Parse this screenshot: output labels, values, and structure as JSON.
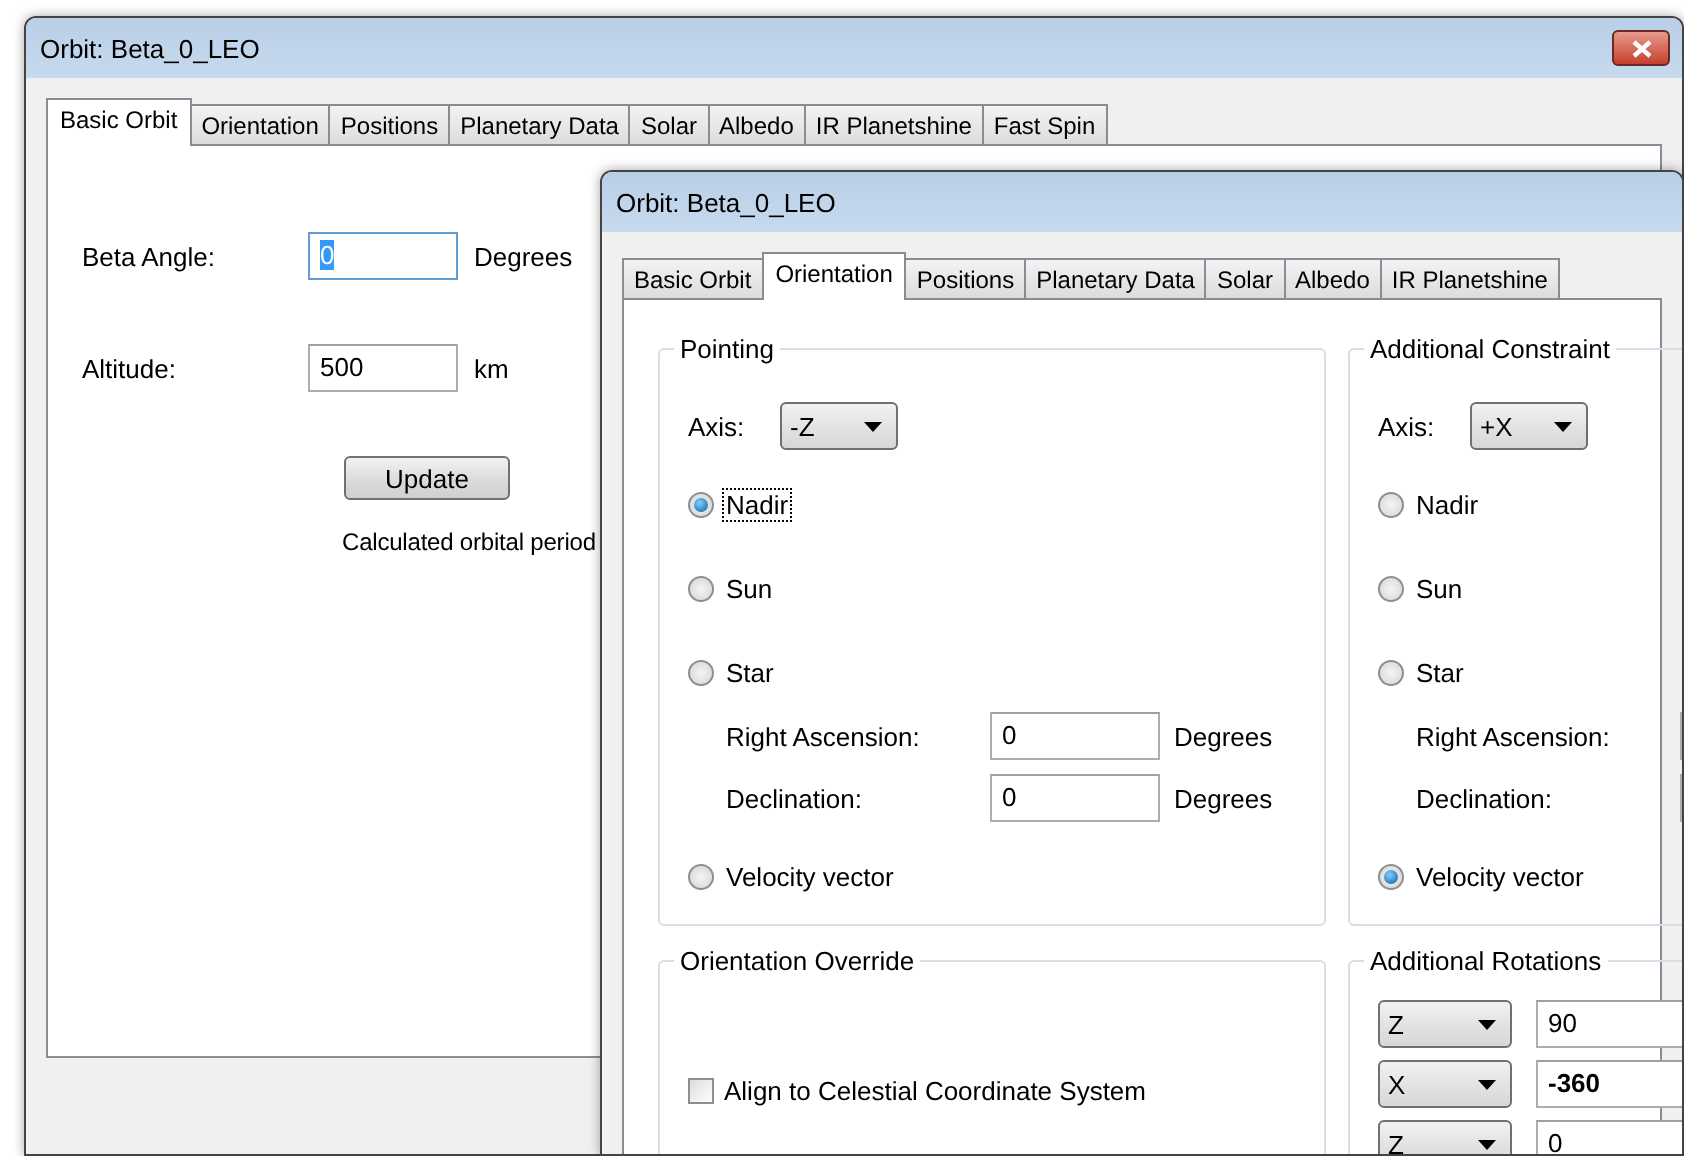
{
  "back_window": {
    "title": "Orbit: Beta_0_LEO",
    "tabs": [
      {
        "label": "Basic Orbit",
        "selected": true
      },
      {
        "label": "Orientation",
        "selected": false
      },
      {
        "label": "Positions",
        "selected": false
      },
      {
        "label": "Planetary Data",
        "selected": false
      },
      {
        "label": "Solar",
        "selected": false
      },
      {
        "label": "Albedo",
        "selected": false
      },
      {
        "label": "IR Planetshine",
        "selected": false
      },
      {
        "label": "Fast Spin",
        "selected": false
      }
    ],
    "fields": [
      {
        "label": "Beta Angle:",
        "value": "0",
        "unit": "Degrees",
        "focused": true
      },
      {
        "label": "Altitude:",
        "value": "500",
        "unit": "km",
        "focused": false
      }
    ],
    "update_button": "Update",
    "period_text": "Calculated orbital period"
  },
  "front_window": {
    "title": "Orbit: Beta_0_LEO",
    "tabs": [
      {
        "label": "Basic Orbit",
        "selected": false
      },
      {
        "label": "Orientation",
        "selected": true
      },
      {
        "label": "Positions",
        "selected": false
      },
      {
        "label": "Planetary Data",
        "selected": false
      },
      {
        "label": "Solar",
        "selected": false
      },
      {
        "label": "Albedo",
        "selected": false
      },
      {
        "label": "IR Planetshine",
        "selected": false
      }
    ],
    "pointing": {
      "title": "Pointing",
      "axis_label": "Axis:",
      "axis": "-Z",
      "options": [
        {
          "label": "Nadir",
          "selected": true,
          "focused": true
        },
        {
          "label": "Sun",
          "selected": false,
          "focused": false
        },
        {
          "label": "Star",
          "selected": false,
          "focused": false,
          "fields": [
            {
              "label": "Right Ascension:",
              "value": "0",
              "unit": "Degrees"
            },
            {
              "label": "Declination:",
              "value": "0",
              "unit": "Degrees"
            }
          ]
        },
        {
          "label": "Velocity vector",
          "selected": false,
          "focused": false
        }
      ]
    },
    "additional_constraint": {
      "title": "Additional Constraint",
      "axis_label": "Axis:",
      "axis": "+X",
      "options": [
        {
          "label": "Nadir",
          "selected": false
        },
        {
          "label": "Sun",
          "selected": false
        },
        {
          "label": "Star",
          "selected": false,
          "fields": [
            {
              "label": "Right Ascension:"
            },
            {
              "label": "Declination:"
            }
          ]
        },
        {
          "label": "Velocity vector",
          "selected": true
        }
      ]
    },
    "orientation_override": {
      "title": "Orientation Override",
      "checkbox": {
        "label": "Align to Celestial Coordinate System",
        "checked": false
      }
    },
    "additional_rotations": {
      "title": "Additional Rotations",
      "rows": [
        {
          "axis": "Z",
          "value": "90",
          "bold": false
        },
        {
          "axis": "X",
          "value": "-360",
          "bold": true
        },
        {
          "axis": "Z",
          "value": "0",
          "bold": false
        }
      ]
    }
  }
}
